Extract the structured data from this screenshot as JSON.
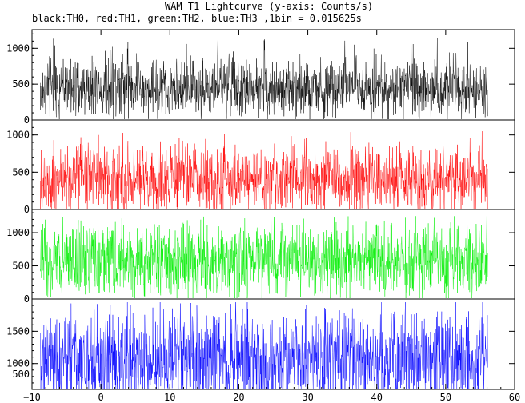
{
  "title": "WAM T1 Lightcurve (y-axis: Counts/s)",
  "subtitle": "black:TH0, red:TH1, green:TH2, blue:TH3 ,1bin = 0.015625s",
  "chart_data": [
    {
      "type": "line",
      "series": [
        {
          "name": "TH0",
          "color": "#000000",
          "baseline": 450,
          "spread": 150,
          "spike_max": 1150,
          "floor": 0,
          "x_start": -8.8,
          "x_end": 56.1
        }
      ],
      "xlim": [
        -10,
        60
      ],
      "ylim": [
        0,
        1260
      ],
      "yticks": [
        0,
        500,
        1000
      ],
      "ytick_labels": [
        "0",
        "500",
        "1000"
      ]
    },
    {
      "type": "line",
      "series": [
        {
          "name": "TH1",
          "color": "#ff0000",
          "baseline": 400,
          "spread": 170,
          "spike_max": 1050,
          "floor": 0,
          "x_start": -8.8,
          "x_end": 56.1
        }
      ],
      "xlim": [
        -10,
        60
      ],
      "ylim": [
        0,
        1200
      ],
      "yticks": [
        0,
        500,
        1000
      ],
      "ytick_labels": [
        "0",
        "500",
        "1000"
      ]
    },
    {
      "type": "line",
      "series": [
        {
          "name": "TH2",
          "color": "#00ee00",
          "baseline": 580,
          "spread": 200,
          "spike_max": 1250,
          "floor": 0,
          "x_start": -8.8,
          "x_end": 56.1
        }
      ],
      "xlim": [
        -10,
        60
      ],
      "ylim": [
        0,
        1350
      ],
      "yticks": [
        0,
        500,
        1000
      ],
      "ytick_labels": [
        "0",
        "500",
        "1000"
      ]
    },
    {
      "type": "line",
      "series": [
        {
          "name": "TH3",
          "color": "#0000ff",
          "baseline": 1070,
          "spread": 280,
          "spike_max": 1950,
          "floor": 500,
          "x_start": -8.8,
          "x_end": 56.1
        }
      ],
      "xlim": [
        -10,
        60
      ],
      "ylim": [
        600,
        2000
      ],
      "yticks": [
        1000,
        1500
      ],
      "ytick_labels": [
        "1000",
        "1500"
      ],
      "extra_label": "500"
    }
  ],
  "x_axis": {
    "ticks": [
      -10,
      0,
      10,
      20,
      30,
      40,
      50,
      60
    ],
    "tick_labels": [
      "−10",
      "0",
      "10",
      "20",
      "30",
      "40",
      "50",
      "60"
    ]
  }
}
